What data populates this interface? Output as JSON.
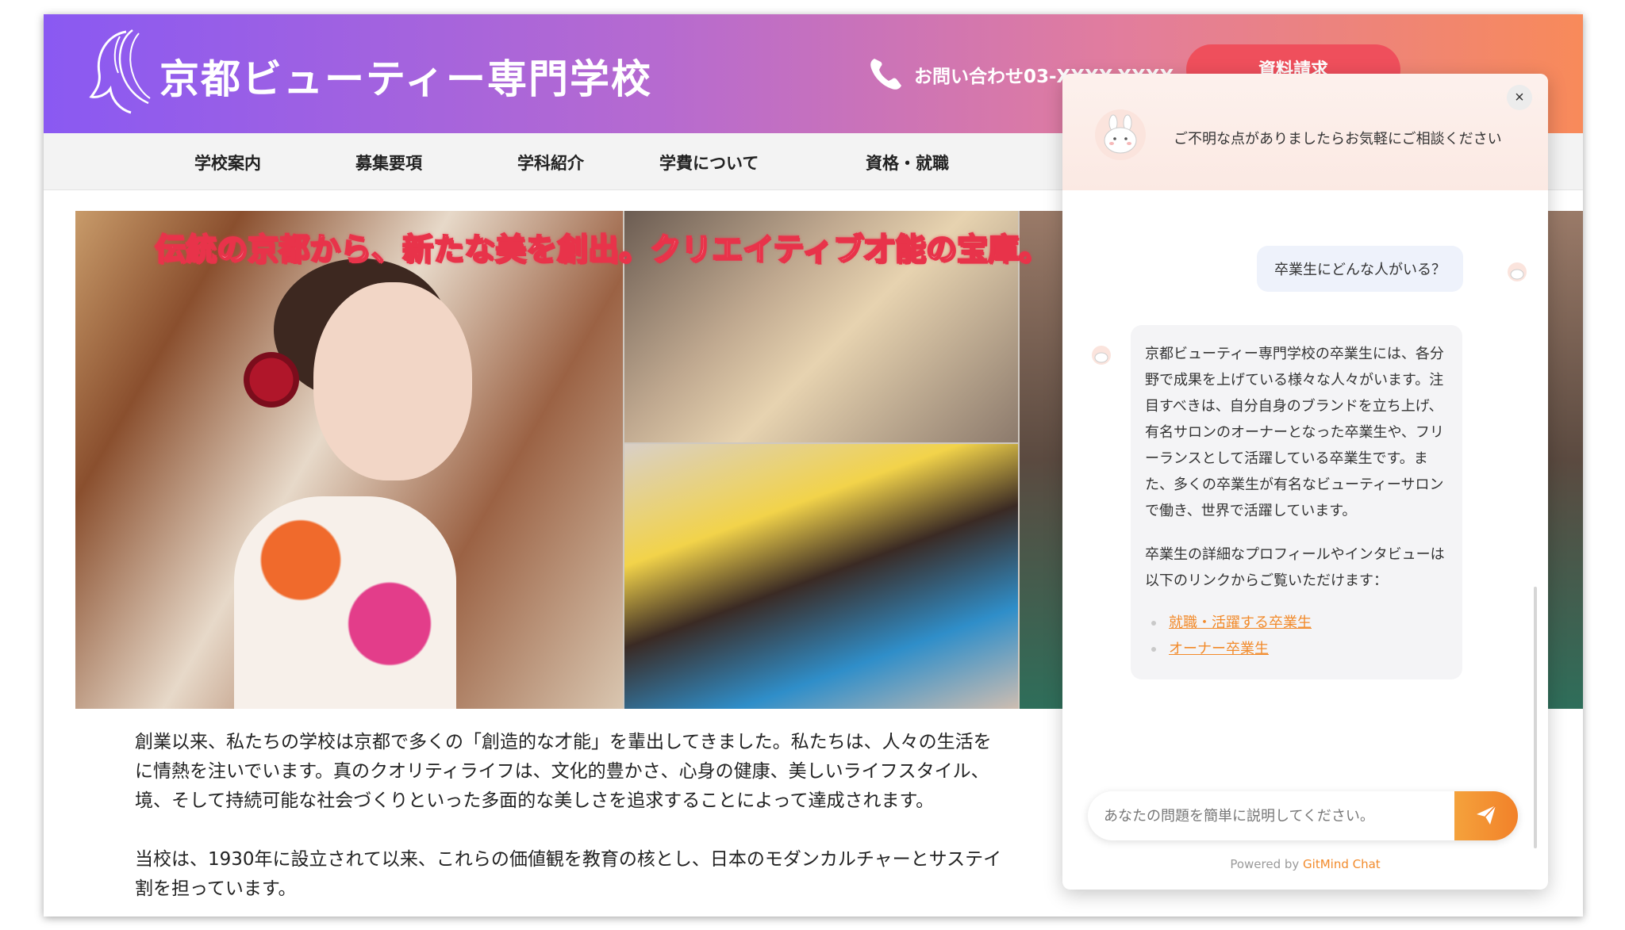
{
  "header": {
    "title": "京都ビューティー専門学校",
    "contact": "お問い合わせ03-XXXX-XXXX",
    "request_button": "資料請求"
  },
  "nav": {
    "items": [
      "学校案内",
      "募集要項",
      "学科紹介",
      "学費について",
      "資格・就職"
    ]
  },
  "hero": {
    "caption": "伝統の京都から、新たな美を創出。クリエイティブ才能の宝庫。"
  },
  "intro": {
    "paragraphs": [
      "創業以来、私たちの学校は京都で多くの「創造的な才能」を輩出してきました。私たちは、人々の生活を\nに情熱を注いでいます。真のクオリティライフは、文化的豊かさ、心身の健康、美しいライフスタイル、\n境、そして持続可能な社会づくりといった多面的な美しさを追求することによって達成されます。",
      "当校は、1930年に設立されて以来、これらの価値観を教育の核とし、日本のモダンカルチャーとサステイ\n割を担っています。"
    ]
  },
  "chat": {
    "greeting": "ご不明な点がありましたらお気軽にご相談ください",
    "close_label": "×",
    "user_message": "卒業生にどんな人がいる？",
    "bot_paragraphs": [
      "京都ビューティー専門学校の卒業生には、各分野で成果を上げている様々な人々がいます。注目すべきは、自分自身のブランドを立ち上げ、有名サロンのオーナーとなった卒業生や、フリーランスとして活躍している卒業生です。また、多くの卒業生が有名なビューティーサロンで働き、世界で活躍しています。",
      "卒業生の詳細なプロフィールやインタビューは以下のリンクからご覧いただけます："
    ],
    "bot_links": [
      "就職・活躍する卒業生",
      "オーナー卒業生"
    ],
    "input_placeholder": "あなたの問題を簡単に説明してください。",
    "powered_prefix": "Powered by ",
    "powered_brand": "GitMind Chat"
  },
  "icons": {
    "logo": "woman-profile-logo-icon",
    "phone": "phone-icon",
    "close": "close-icon",
    "bot": "bunny-bot-avatar-icon",
    "send": "paper-plane-send-icon"
  },
  "colors": {
    "header_gradient_start": "#8a59f2",
    "header_gradient_end": "#f88a5a",
    "request_button": "#ef4f5c",
    "accent_orange": "#f28a2a",
    "caption_outline": "#e8334a"
  }
}
